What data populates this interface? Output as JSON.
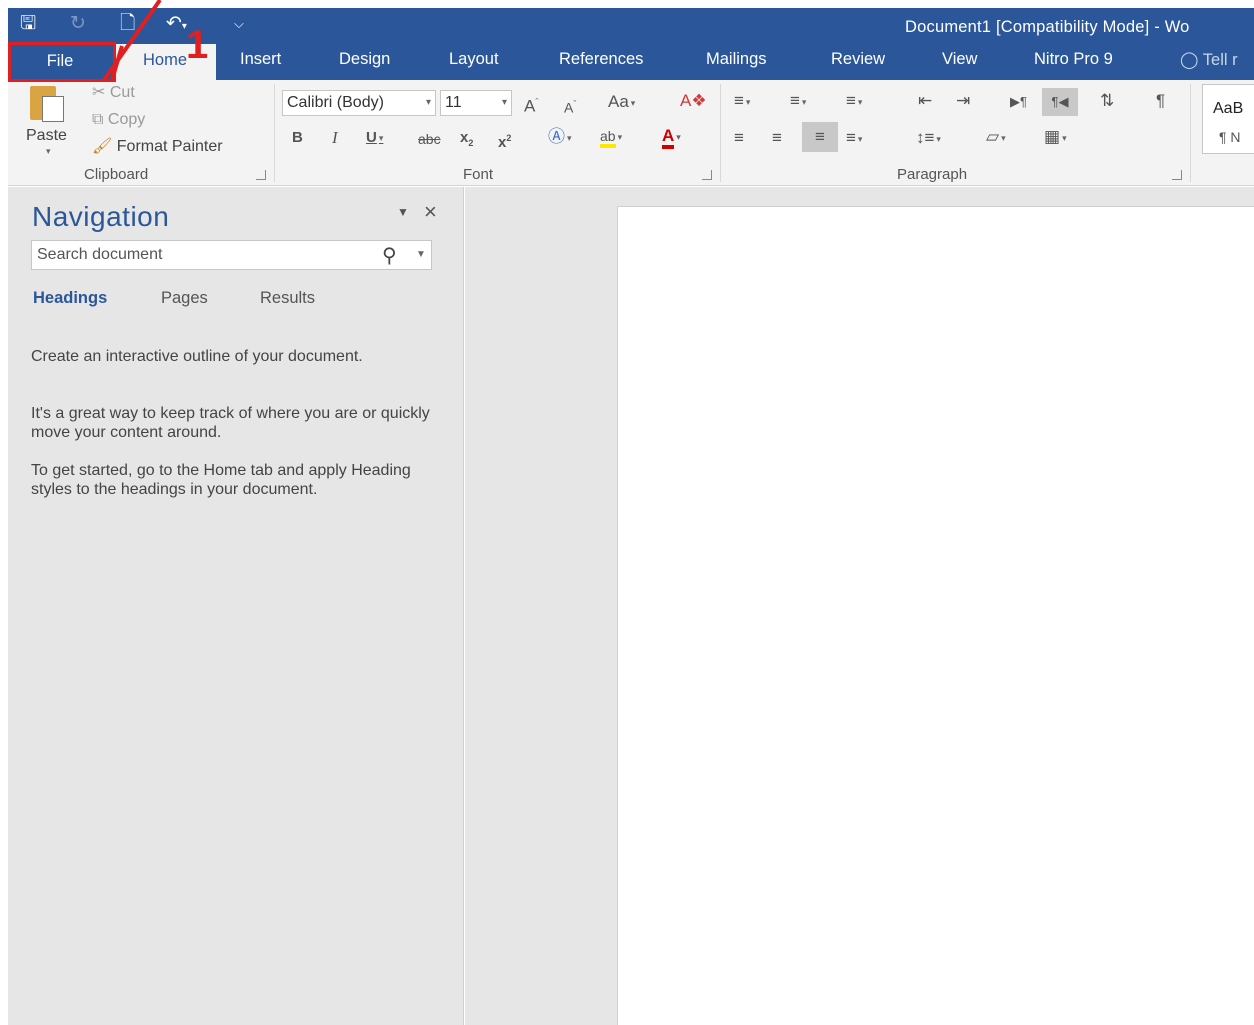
{
  "window": {
    "title": "Document1 [Compatibility Mode] - Wo",
    "quick_access": {
      "save_icon": "save-icon",
      "redo_icon": "redo-icon",
      "new_doc_icon": "new-document-icon",
      "undo_icon": "undo-icon",
      "customize_icon": "customize-quick-access-icon"
    }
  },
  "tabs": {
    "file": "File",
    "home": "Home",
    "insert": "Insert",
    "design": "Design",
    "layout": "Layout",
    "references": "References",
    "mailings": "Mailings",
    "review": "Review",
    "view": "View",
    "nitro": "Nitro Pro 9",
    "tell_me": "Tell r"
  },
  "annotation": {
    "number": "1",
    "color": "#e02020"
  },
  "ribbon": {
    "clipboard": {
      "paste": "Paste",
      "cut": "Cut",
      "copy": "Copy",
      "format_painter": "Format Painter",
      "label": "Clipboard"
    },
    "font": {
      "name": "Calibri (Body)",
      "size": "11",
      "change_case": "Aa",
      "label": "Font",
      "strikethrough": "abc"
    },
    "paragraph": {
      "label": "Paragraph"
    },
    "styles": {
      "sample": "AaB",
      "normal": "¶ N"
    }
  },
  "navigation": {
    "title": "Navigation",
    "search_placeholder": "Search document",
    "tabs": [
      "Headings",
      "Pages",
      "Results"
    ],
    "paragraphs": [
      "Create an interactive outline of your document.",
      "It's a great way to keep track of where you are or quickly move your content around.",
      "To get started, go to the Home tab and apply Heading styles to the headings in your document."
    ]
  },
  "colors": {
    "accent": "#2b579a",
    "ribbon_bg": "#f3f3f3",
    "pane_bg": "#e6e6e6",
    "annotation": "#e02020"
  }
}
